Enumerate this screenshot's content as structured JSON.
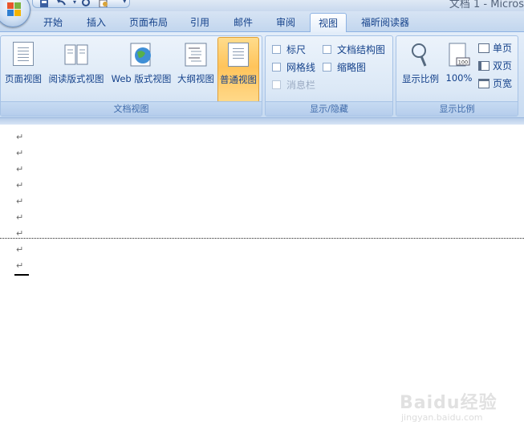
{
  "window": {
    "title": "文档 1 - Micros"
  },
  "tabs": [
    {
      "label": "开始"
    },
    {
      "label": "插入"
    },
    {
      "label": "页面布局"
    },
    {
      "label": "引用"
    },
    {
      "label": "邮件"
    },
    {
      "label": "审阅"
    },
    {
      "label": "视图",
      "active": true
    },
    {
      "label": "福昕阅读器"
    }
  ],
  "ribbon": {
    "doc_views": {
      "label": "文档视图",
      "buttons": [
        {
          "label": "页面视图"
        },
        {
          "label": "阅读版式视图"
        },
        {
          "label": "Web 版式视图"
        },
        {
          "label": "大纲视图"
        },
        {
          "label": "普通视图",
          "selected": true
        }
      ]
    },
    "show_hide": {
      "label": "显示/隐藏",
      "items": [
        {
          "label": "标尺",
          "checked": false,
          "enabled": true
        },
        {
          "label": "文档结构图",
          "checked": false,
          "enabled": true
        },
        {
          "label": "网格线",
          "checked": false,
          "enabled": true
        },
        {
          "label": "缩略图",
          "checked": false,
          "enabled": true
        },
        {
          "label": "消息栏",
          "checked": false,
          "enabled": false
        }
      ]
    },
    "zoom": {
      "label": "显示比例",
      "zoom_button": "显示比例",
      "hundred_button": "100%",
      "hundred_icon_text": "100",
      "one_page": "单页",
      "two_pages": "双页",
      "page_width": "页宽"
    }
  },
  "document": {
    "paragraph_mark": "↵",
    "marks_before_break": 7,
    "marks_after_break": 2
  },
  "watermark": {
    "brand": "Baidu经验",
    "url": "jingyan.baidu.com"
  },
  "colors": {
    "accent": "#15428b",
    "ribbon_bg": "#dbe8f6",
    "selected_button": "#ffc45b",
    "tab_bar": "#c2d6ee"
  }
}
